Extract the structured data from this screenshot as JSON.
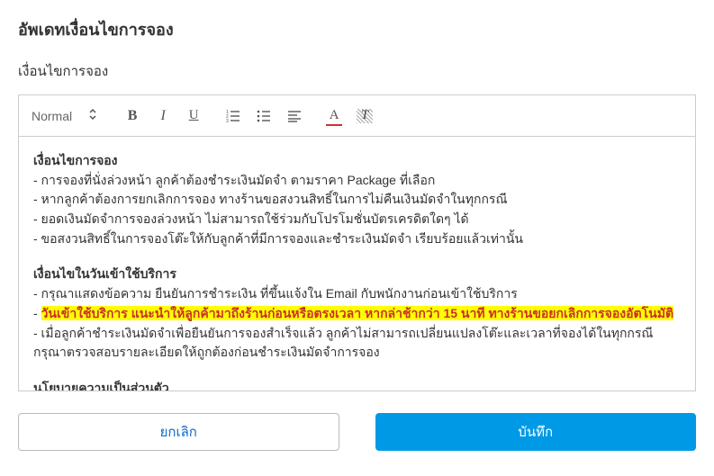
{
  "page": {
    "title": "อัพเดทเงื่อนไขการจอง",
    "section_label": "เงื่อนไขการจอง"
  },
  "toolbar": {
    "format": "Normal"
  },
  "content": {
    "h1": "เงื่อนไขการจอง",
    "l1": "- การจองที่นั่งล่วงหน้า ลูกค้าต้องชำระเงินมัดจำ ตามราคา Package ที่เลือก",
    "l2": "- หากลูกค้าต้องการยกเลิกการจอง ทางร้านขอสงวนสิทธิ์ในการไม่คืนเงินมัดจำในทุกกรณี",
    "l3": "- ยอดเงินมัดจำการจองล่วงหน้า ไม่สามารถใช้ร่วมกับโปรโมชั่นบัตรเครดิตใดๆ ได้",
    "l4": "- ขอสงวนสิทธิ์ในการจองโต๊ะให้กับลูกค้าที่มีการจองและชำระเงินมัดจำ เรียบร้อยแล้วเท่านั้น",
    "h2": "เงื่อนไขในวันเข้าใช้บริการ",
    "l5": "- กรุณาแสดงข้อความ ยืนยันการชำระเงิน ที่ขึ้นแจ้งใน Email กับพนักงานก่อนเข้าใช้บริการ",
    "l6_pre": "- ",
    "l6_hl": "วันเข้าใช้บริการ แนะนำให้ลูกค้ามาถึงร้านก่อนหรือตรงเวลา หากล่าช้ากว่า 15 นาที ทางร้านขอยกเลิกการจองอัตโนมัติ",
    "l7": "- เมื่อลูกค้าชำระเงินมัดจำเพื่อยืนยันการจองสำเร็จแล้ว ลูกค้าไม่สามารถเปลี่ยนแปลงโต๊ะและเวลาที่จองได้ในทุกกรณี",
    "l8": "กรุณาตรวจสอบรายละเอียดให้ถูกต้องก่อนชำระเงินมัดจำการจอง",
    "h3": "นโยบายความเป็นส่วนตัว"
  },
  "buttons": {
    "cancel": "ยกเลิก",
    "save": "บันทึก"
  }
}
